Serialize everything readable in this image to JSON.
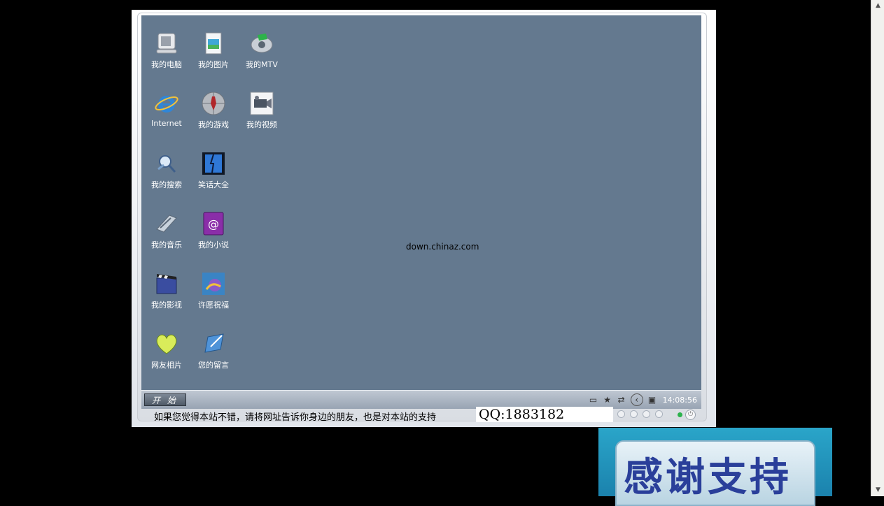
{
  "desktop": {
    "center_text": "down.chinaz.com",
    "icons": [
      {
        "label": "我的电脑",
        "icon": "computer-icon"
      },
      {
        "label": "我的图片",
        "icon": "pictures-icon"
      },
      {
        "label": "我的MTV",
        "icon": "mtv-icon"
      },
      {
        "label": "Internet",
        "icon": "internet-explorer-icon"
      },
      {
        "label": "我的游戏",
        "icon": "games-icon"
      },
      {
        "label": "我的视频",
        "icon": "video-camera-icon"
      },
      {
        "label": "我的搜索",
        "icon": "search-icon"
      },
      {
        "label": "笑话大全",
        "icon": "jokes-icon"
      },
      {
        "label": "我的音乐",
        "icon": "music-icon"
      },
      {
        "label": "我的小说",
        "icon": "novel-icon"
      },
      {
        "label": "我的影视",
        "icon": "movies-icon"
      },
      {
        "label": "许愿祝福",
        "icon": "wishes-icon"
      },
      {
        "label": "网友相片",
        "icon": "friends-photos-icon"
      },
      {
        "label": "您的留言",
        "icon": "guestbook-icon"
      }
    ]
  },
  "taskbar": {
    "start_label": "开 始",
    "clock": "14:08:56",
    "tray_icons": [
      "folder-icon",
      "star-icon",
      "network-icon",
      "back-icon",
      "monitor-icon"
    ]
  },
  "ticker": {
    "message": "如果您觉得本站不错，请将网址告诉你身边的朋友，也是对本站的支持",
    "qq": "QQ:1883182"
  },
  "banner": {
    "text": "感谢支持"
  },
  "colors": {
    "desktop_bg": "#64798f",
    "banner_bg": "#1b82ad",
    "banner_text": "#2a3f9a"
  }
}
